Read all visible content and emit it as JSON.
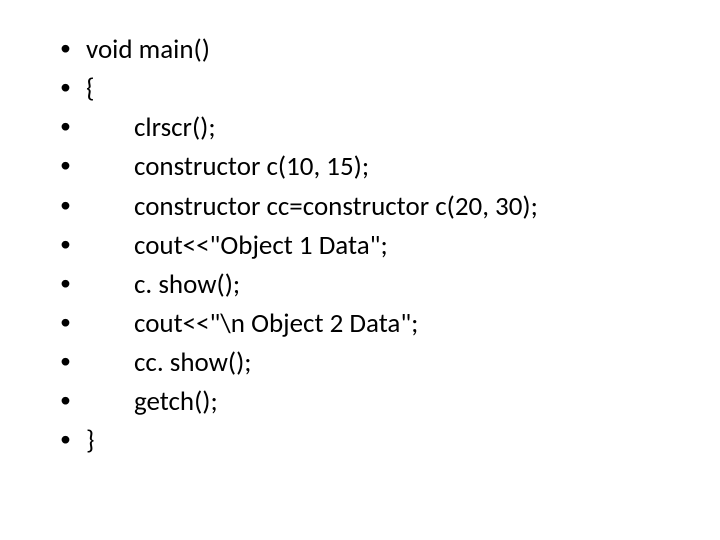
{
  "lines": [
    {
      "indent": 0,
      "text": "void main()"
    },
    {
      "indent": 0,
      "text": "{"
    },
    {
      "indent": 1,
      "text": "clrscr();"
    },
    {
      "indent": 1,
      "text": "constructor c(10, 15);"
    },
    {
      "indent": 1,
      "text": "constructor cc=constructor c(20, 30);"
    },
    {
      "indent": 1,
      "text": "cout<<\"Object 1 Data\";"
    },
    {
      "indent": 1,
      "text": "c. show();"
    },
    {
      "indent": 1,
      "text": "cout<<\"\\n Object 2 Data\";"
    },
    {
      "indent": 1,
      "text": "cc. show();"
    },
    {
      "indent": 1,
      "text": "getch();"
    },
    {
      "indent": 0,
      "text": "}"
    }
  ],
  "bullet_glyph": "•"
}
